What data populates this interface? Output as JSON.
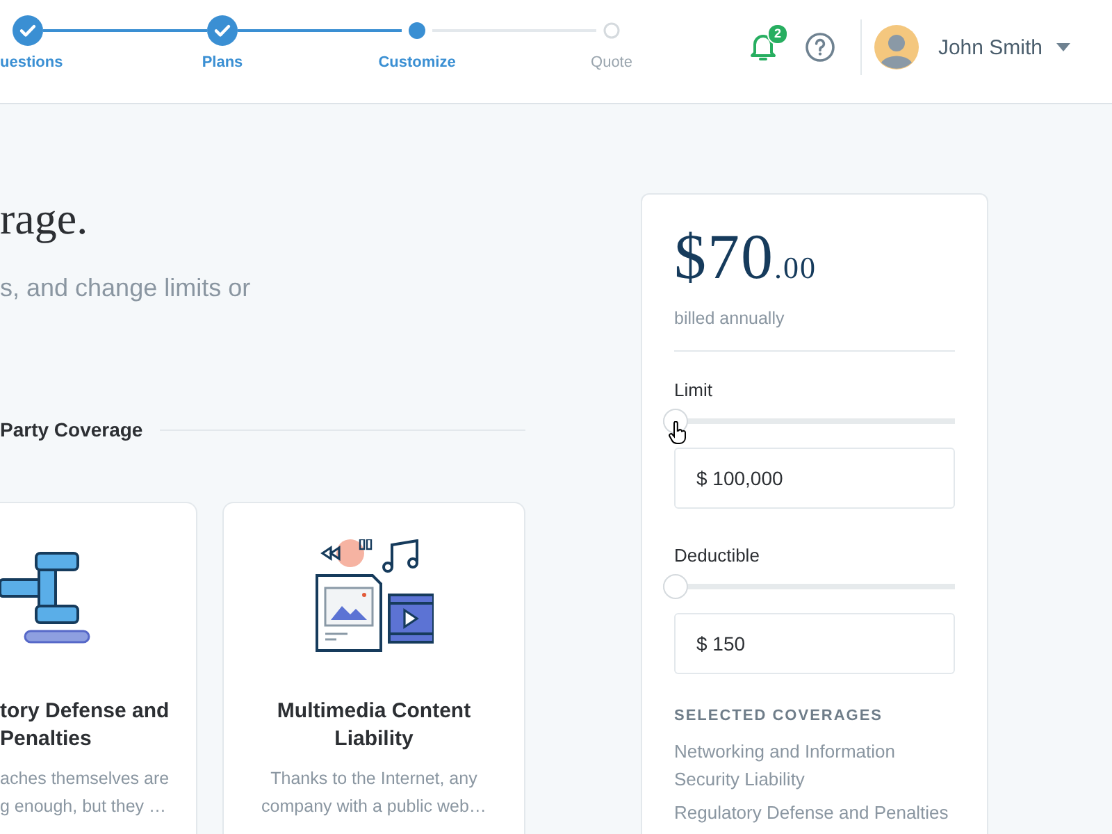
{
  "stepper": {
    "steps": [
      {
        "label": "uestions",
        "done": true,
        "selected": false
      },
      {
        "label": "Plans",
        "done": true,
        "selected": false
      },
      {
        "label": "Customize",
        "done": false,
        "selected": true
      },
      {
        "label": "Quote",
        "done": false,
        "selected": false
      }
    ]
  },
  "header": {
    "notifications": {
      "count": "2"
    },
    "user": {
      "name": "John Smith"
    }
  },
  "intro": {
    "heading": "rage.",
    "subtitle": "s, and change limits or"
  },
  "section": {
    "title": "Party Coverage",
    "cards": [
      {
        "kind": "gavel",
        "title_lines": [
          "tory Defense and",
          "Penalties"
        ],
        "description_lines": [
          "aches themselves are",
          "g enough, but they …"
        ]
      },
      {
        "kind": "multimedia",
        "title_lines": [
          "Multimedia Content",
          "Liability"
        ],
        "description_lines": [
          "Thanks to the Internet, any",
          "company with a public web…"
        ]
      }
    ]
  },
  "summary": {
    "price": {
      "amount": "$70",
      "cents": ".00",
      "period": "billed annually"
    },
    "controls": [
      {
        "label": "Limit",
        "level": 0,
        "value": "$ 100,000"
      },
      {
        "label": "Deductible",
        "level": 0,
        "value": "$ 150"
      }
    ],
    "selected": {
      "title": "SELECTED COVERAGES",
      "items": [
        "Networking and Information Security Liability",
        "Regulatory Defense and Penalties"
      ]
    }
  }
}
